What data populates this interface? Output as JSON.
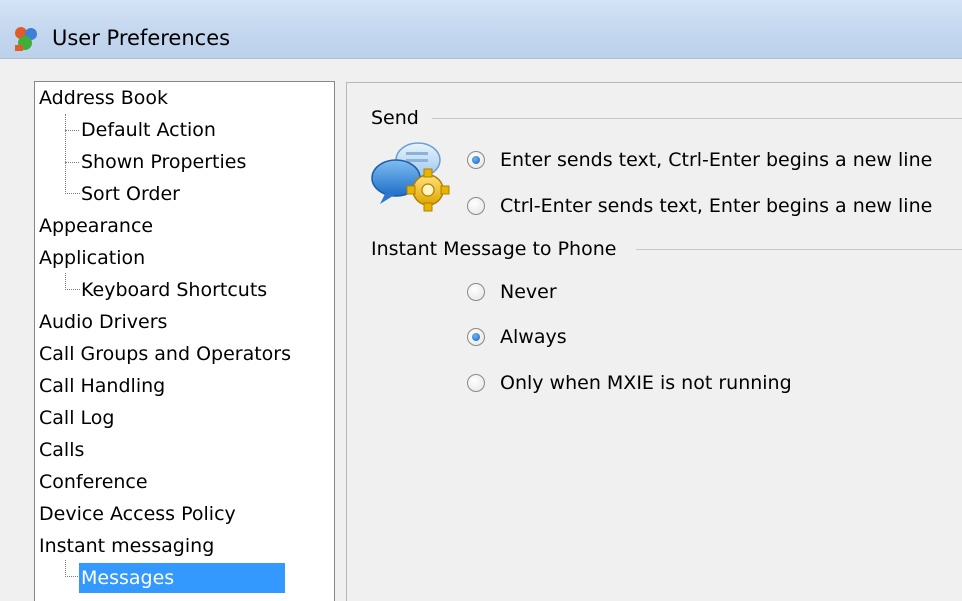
{
  "window": {
    "title": "User Preferences"
  },
  "tree": {
    "items": [
      {
        "label": "Address Book",
        "level": 0
      },
      {
        "label": "Default Action",
        "level": 1
      },
      {
        "label": "Shown Properties",
        "level": 1
      },
      {
        "label": "Sort Order",
        "level": 1
      },
      {
        "label": "Appearance",
        "level": 0
      },
      {
        "label": "Application",
        "level": 0
      },
      {
        "label": "Keyboard Shortcuts",
        "level": 1
      },
      {
        "label": "Audio Drivers",
        "level": 0
      },
      {
        "label": "Call Groups and Operators",
        "level": 0
      },
      {
        "label": "Call Handling",
        "level": 0
      },
      {
        "label": "Call Log",
        "level": 0
      },
      {
        "label": "Calls",
        "level": 0
      },
      {
        "label": "Conference",
        "level": 0
      },
      {
        "label": "Device Access Policy",
        "level": 0
      },
      {
        "label": "Instant messaging",
        "level": 0
      },
      {
        "label": "Messages",
        "level": 1,
        "selected": true
      }
    ]
  },
  "send_group": {
    "label": "Send",
    "icon": "chat-settings-icon",
    "options": [
      {
        "label": "Enter sends text, Ctrl-Enter begins a new line",
        "checked": true
      },
      {
        "label": "Ctrl-Enter sends text, Enter begins a new line",
        "checked": false
      }
    ]
  },
  "phone_group": {
    "label": "Instant Message to Phone",
    "options": [
      {
        "label": "Never",
        "checked": false
      },
      {
        "label": "Always",
        "checked": true
      },
      {
        "label": "Only when MXIE is not running",
        "checked": false
      }
    ]
  },
  "colors": {
    "selection": "#3399ff",
    "titlebar": "#c2d6ee",
    "panel": "#f0f0f0"
  }
}
